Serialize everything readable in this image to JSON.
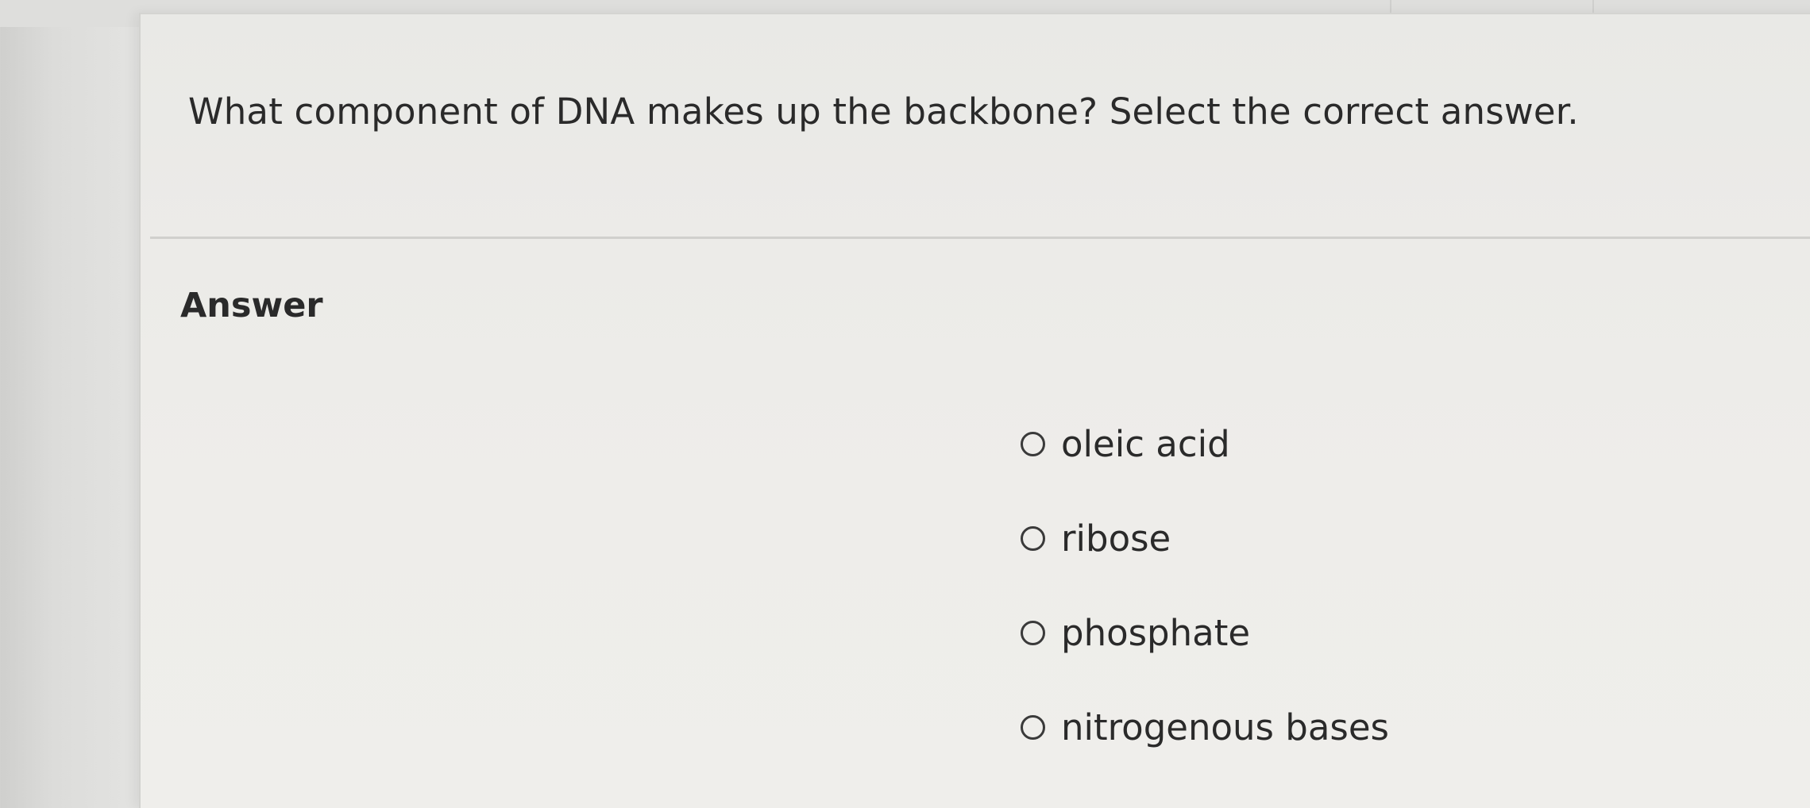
{
  "question": {
    "text": "What component of DNA makes up the backbone? Select the correct answer."
  },
  "answer": {
    "heading": "Answer",
    "options": [
      {
        "label": "oleic acid",
        "selected": false
      },
      {
        "label": "ribose",
        "selected": false
      },
      {
        "label": "phosphate",
        "selected": false
      },
      {
        "label": "nitrogenous bases",
        "selected": false
      }
    ]
  },
  "colors": {
    "background": "#e6e6e4",
    "card": "#eeedea",
    "text": "#2a2a2a",
    "radio_border": "#3a3a3a"
  },
  "icons": {
    "radio": "radio-unchecked-icon"
  }
}
